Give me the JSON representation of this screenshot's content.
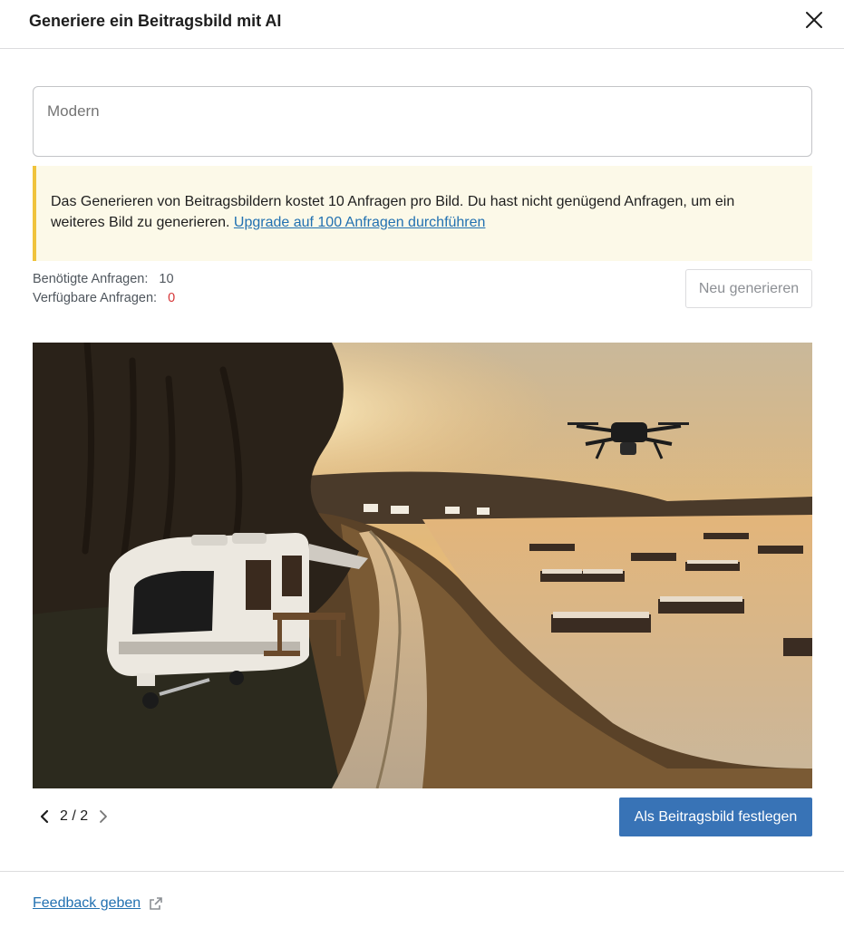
{
  "dialog": {
    "title": "Generiere ein Beitragsbild mit AI",
    "close_icon": "close-icon"
  },
  "prompt": {
    "value": "Modern"
  },
  "notice": {
    "text": "Das Generieren von Beitragsbildern kostet 10 Anfragen pro Bild. Du hast nicht genügend Anfragen, um ein weiteres Bild zu generieren. ",
    "link_text": "Upgrade auf 100 Anfragen durchführen",
    "accent_color": "#f0c33c"
  },
  "stats": {
    "required_label": "Benötigte Anfragen:",
    "required_value": "10",
    "available_label": "Verfügbare Anfragen:",
    "available_value": "0"
  },
  "buttons": {
    "regenerate": "Neu generieren",
    "set_featured": "Als Beitragsbild festlegen",
    "primary_color": "#3873b6"
  },
  "pager": {
    "current": "2 / 2",
    "prev_icon": "chevron-left-icon",
    "next_icon": "chevron-right-icon"
  },
  "footer": {
    "feedback_label": "Feedback geben",
    "external_icon": "external-link-icon"
  }
}
